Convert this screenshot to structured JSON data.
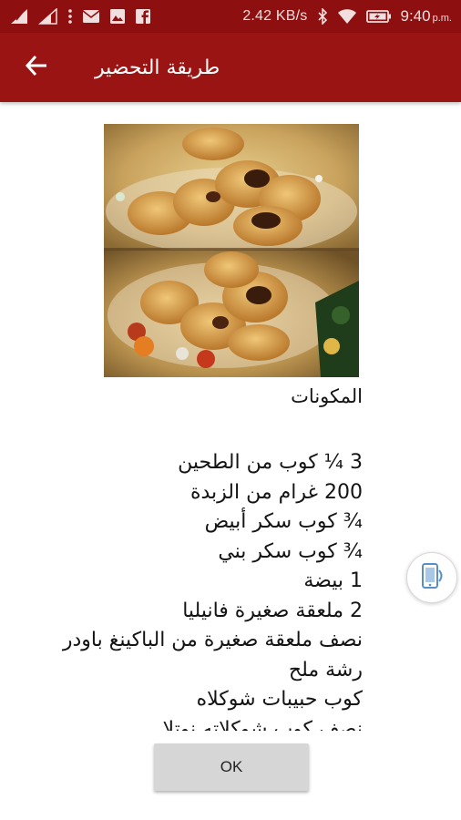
{
  "status_bar": {
    "network_speed": "2.42 KB/s",
    "time": "9:40",
    "ampm": "p.m.",
    "icons": [
      "signal-icon",
      "signal-icon",
      "more-vertical-icon",
      "mail-icon",
      "image-icon",
      "facebook-icon",
      "bluetooth-icon",
      "wifi-icon",
      "battery-charging-icon"
    ]
  },
  "app_bar": {
    "title": "طريقة التحضير",
    "back_icon": "arrow-left-icon"
  },
  "recipe": {
    "section_title": "المكونات",
    "ingredients": [
      "3 ¼ كوب من الطحين",
      "200 غرام من الزبدة",
      "¾ كوب سكر أبيض",
      "¾ كوب سكر بني",
      "1 بيضة",
      "2 ملعقة صغيرة فانيليا",
      "نصف ملعقة صغيرة من الباكينغ باودر",
      "رشة ملح",
      "كوب حبيبات شوكلاه",
      "نصف كوب شوكلاته نوتلا"
    ]
  },
  "floating_button": {
    "icon": "phone-transfer-icon"
  },
  "dialog": {
    "ok_label": "OK"
  },
  "colors": {
    "status_bar": "#8e0f0f",
    "app_bar": "#9b1414",
    "button": "#d6d6d6"
  }
}
